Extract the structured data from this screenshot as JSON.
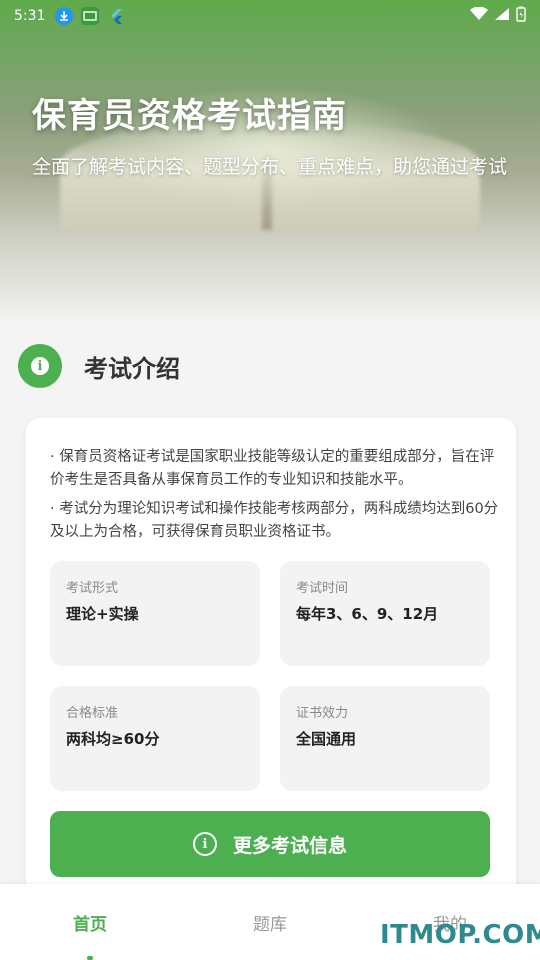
{
  "status_bar": {
    "time": "5:31",
    "icons": [
      "download-icon",
      "app-badge-icon",
      "flutter-icon"
    ],
    "right_icons": [
      "wifi-icon",
      "signal-icon",
      "battery-icon"
    ]
  },
  "hero": {
    "title": "保育员资格考试指南",
    "subtitle": "全面了解考试内容、题型分布、重点难点，助您通过考试"
  },
  "section": {
    "title": "考试介绍",
    "icon": "info-icon"
  },
  "intro": {
    "paragraphs": [
      "· 保育员资格证考试是国家职业技能等级认定的重要组成部分，旨在评价考生是否具备从事保育员工作的专业知识和技能水平。",
      "· 考试分为理论知识考试和操作技能考核两部分，两科成绩均达到60分及以上为合格，可获得保育员职业资格证书。"
    ],
    "tiles": [
      {
        "label": "考试形式",
        "value": "理论+实操"
      },
      {
        "label": "考试时间",
        "value": "每年3、6、9、12月"
      },
      {
        "label": "合格标准",
        "value": "两科均≥60分"
      },
      {
        "label": "证书效力",
        "value": "全国通用"
      }
    ],
    "more_button": "更多考试信息"
  },
  "tabbar": {
    "tabs": [
      {
        "label": "首页",
        "active": true
      },
      {
        "label": "题库",
        "active": false
      },
      {
        "label": "我的",
        "active": false
      }
    ]
  },
  "watermark": "ITMOP.COM",
  "colors": {
    "accent": "#4caf50",
    "watermark": "#2e8a8f"
  }
}
